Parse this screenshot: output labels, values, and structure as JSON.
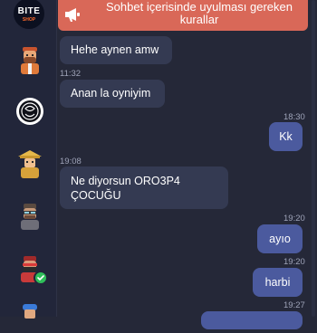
{
  "brand": {
    "line1": "BITE",
    "line2": "SHOP"
  },
  "banner": {
    "text": "Sohbet içerisinde uyulması gereken kurallar",
    "icon": "megaphone-icon"
  },
  "messages": [
    {
      "text": "Hehe aynen amw",
      "time": "",
      "direction": "incoming"
    },
    {
      "text": "Anan la oyniyim",
      "time": "11:32",
      "direction": "incoming"
    },
    {
      "text": "Kk",
      "time": "18:30",
      "direction": "outgoing"
    },
    {
      "text": "Ne diyorsun ORO3P4 ÇOCUĞU",
      "time": "19:08",
      "direction": "incoming"
    },
    {
      "text": "ayıo",
      "time": "19:20",
      "direction": "outgoing"
    },
    {
      "text": "harbi",
      "time": "19:20",
      "direction": "outgoing"
    },
    {
      "text": "",
      "time": "19:27",
      "direction": "outgoing"
    }
  ],
  "colors": {
    "background": "#252838",
    "incoming": "#343a52",
    "outgoing": "#4b5a9e",
    "banner": "#d96858",
    "online": "#2fbf5a"
  }
}
